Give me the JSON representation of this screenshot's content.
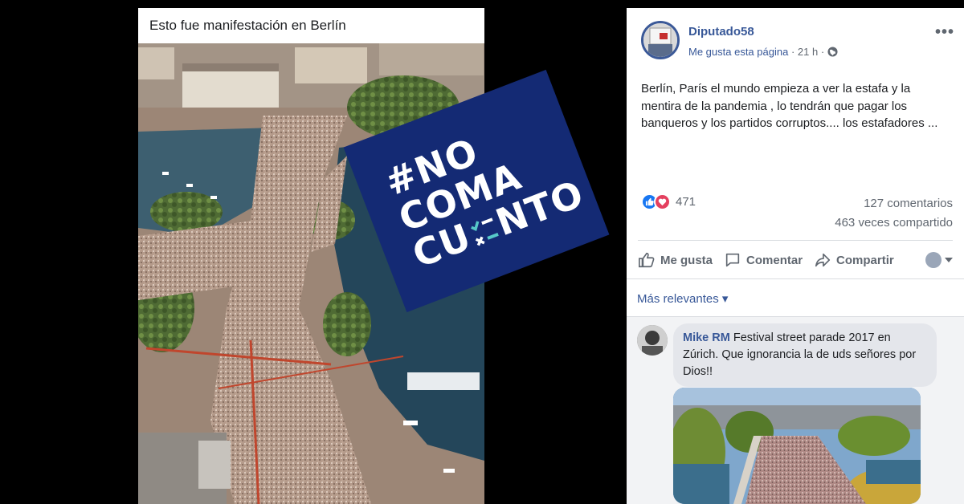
{
  "photo": {
    "caption": "Esto fue manifestación en  Berlín"
  },
  "stamp": {
    "line1": "#NO",
    "line2": "COMA",
    "line3a": "CU",
    "line3b": "NTO",
    "brand_color": "#142a74"
  },
  "post": {
    "page_name": "Diputado58",
    "like_page": "Me gusta esta página",
    "time": "21 h",
    "separator": "·",
    "globe_icon": "globe-icon",
    "more": "•••",
    "text": "Berlín, París el mundo empieza a ver la estafa y la mentira de la pandemia , lo tendrán que pagar los banqueros y los partidos corruptos.... los estafadores ...",
    "reaction_count": "471",
    "comments_count": "127 comentarios",
    "shares_count": "463 veces compartido",
    "actions": {
      "like": "Me gusta",
      "comment": "Comentar",
      "share": "Compartir"
    },
    "sort": "Más relevantes ▾"
  },
  "comment": {
    "author": "Mike RM",
    "text": " Festival street parade 2017 en Zúrich. Que ignorancia la de uds señores por Dios!!"
  },
  "colors": {
    "fb_blue": "#385898",
    "like_blue": "#1877f2",
    "love_red": "#e4405f"
  }
}
